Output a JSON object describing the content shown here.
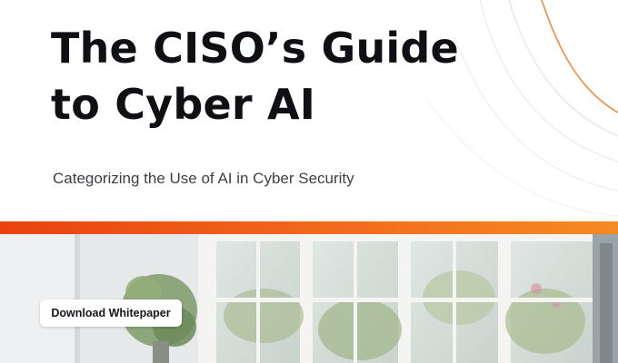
{
  "hero": {
    "title_line1": "The CISO’s Guide",
    "title_line2": "to Cyber AI",
    "subtitle": "Categorizing the Use of AI in Cyber Security"
  },
  "cta": {
    "download_label": "Download Whitepaper"
  },
  "colors": {
    "accent_start": "#e8420f",
    "accent_end": "#f58a24",
    "title_text": "#0f1013",
    "subtitle_text": "#3c3f45",
    "decor_line": "#f08a3c"
  },
  "icons": {
    "decor": "orange-curve-lines"
  }
}
